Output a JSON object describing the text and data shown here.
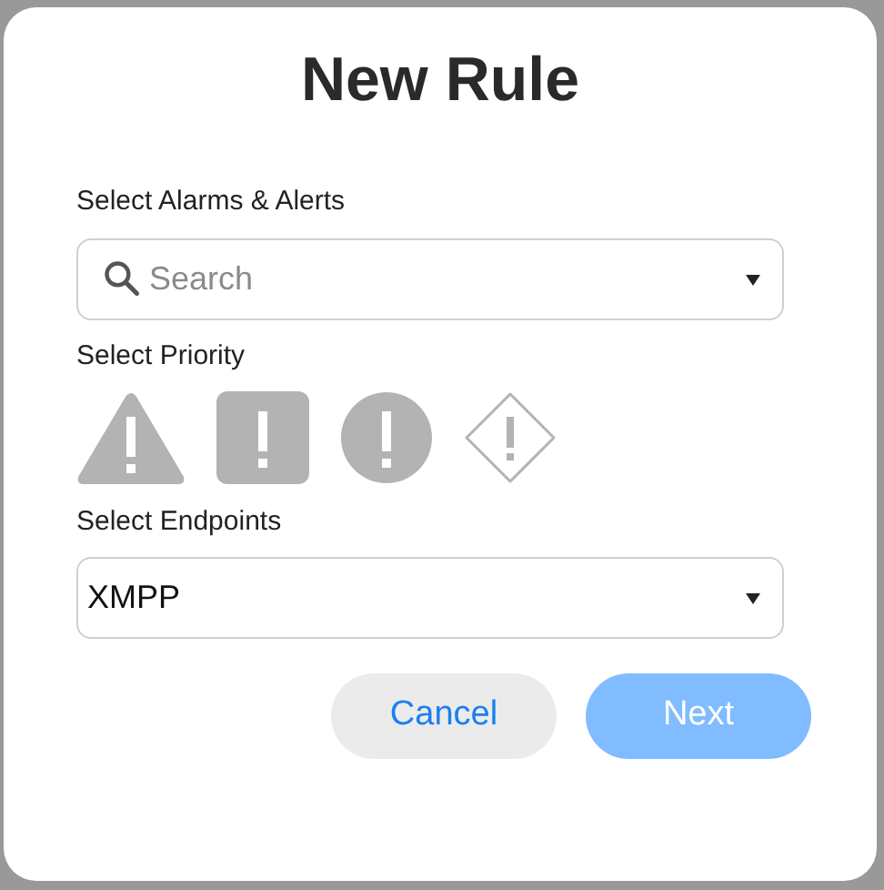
{
  "dialog": {
    "title": "New Rule"
  },
  "alarms": {
    "label": "Select Alarms & Alerts",
    "placeholder": "Search"
  },
  "priority": {
    "label": "Select Priority",
    "levels": [
      {
        "kind": "triangle",
        "selected": false
      },
      {
        "kind": "square",
        "selected": false
      },
      {
        "kind": "circle",
        "selected": false
      },
      {
        "kind": "diamond",
        "selected": false
      }
    ]
  },
  "endpoints": {
    "label": "Select Endpoints",
    "value": "XMPP"
  },
  "buttons": [
    {
      "label": "Cancel",
      "kind": "secondary",
      "disabled": false
    },
    {
      "label": "Next",
      "kind": "primary",
      "disabled": true
    }
  ]
}
